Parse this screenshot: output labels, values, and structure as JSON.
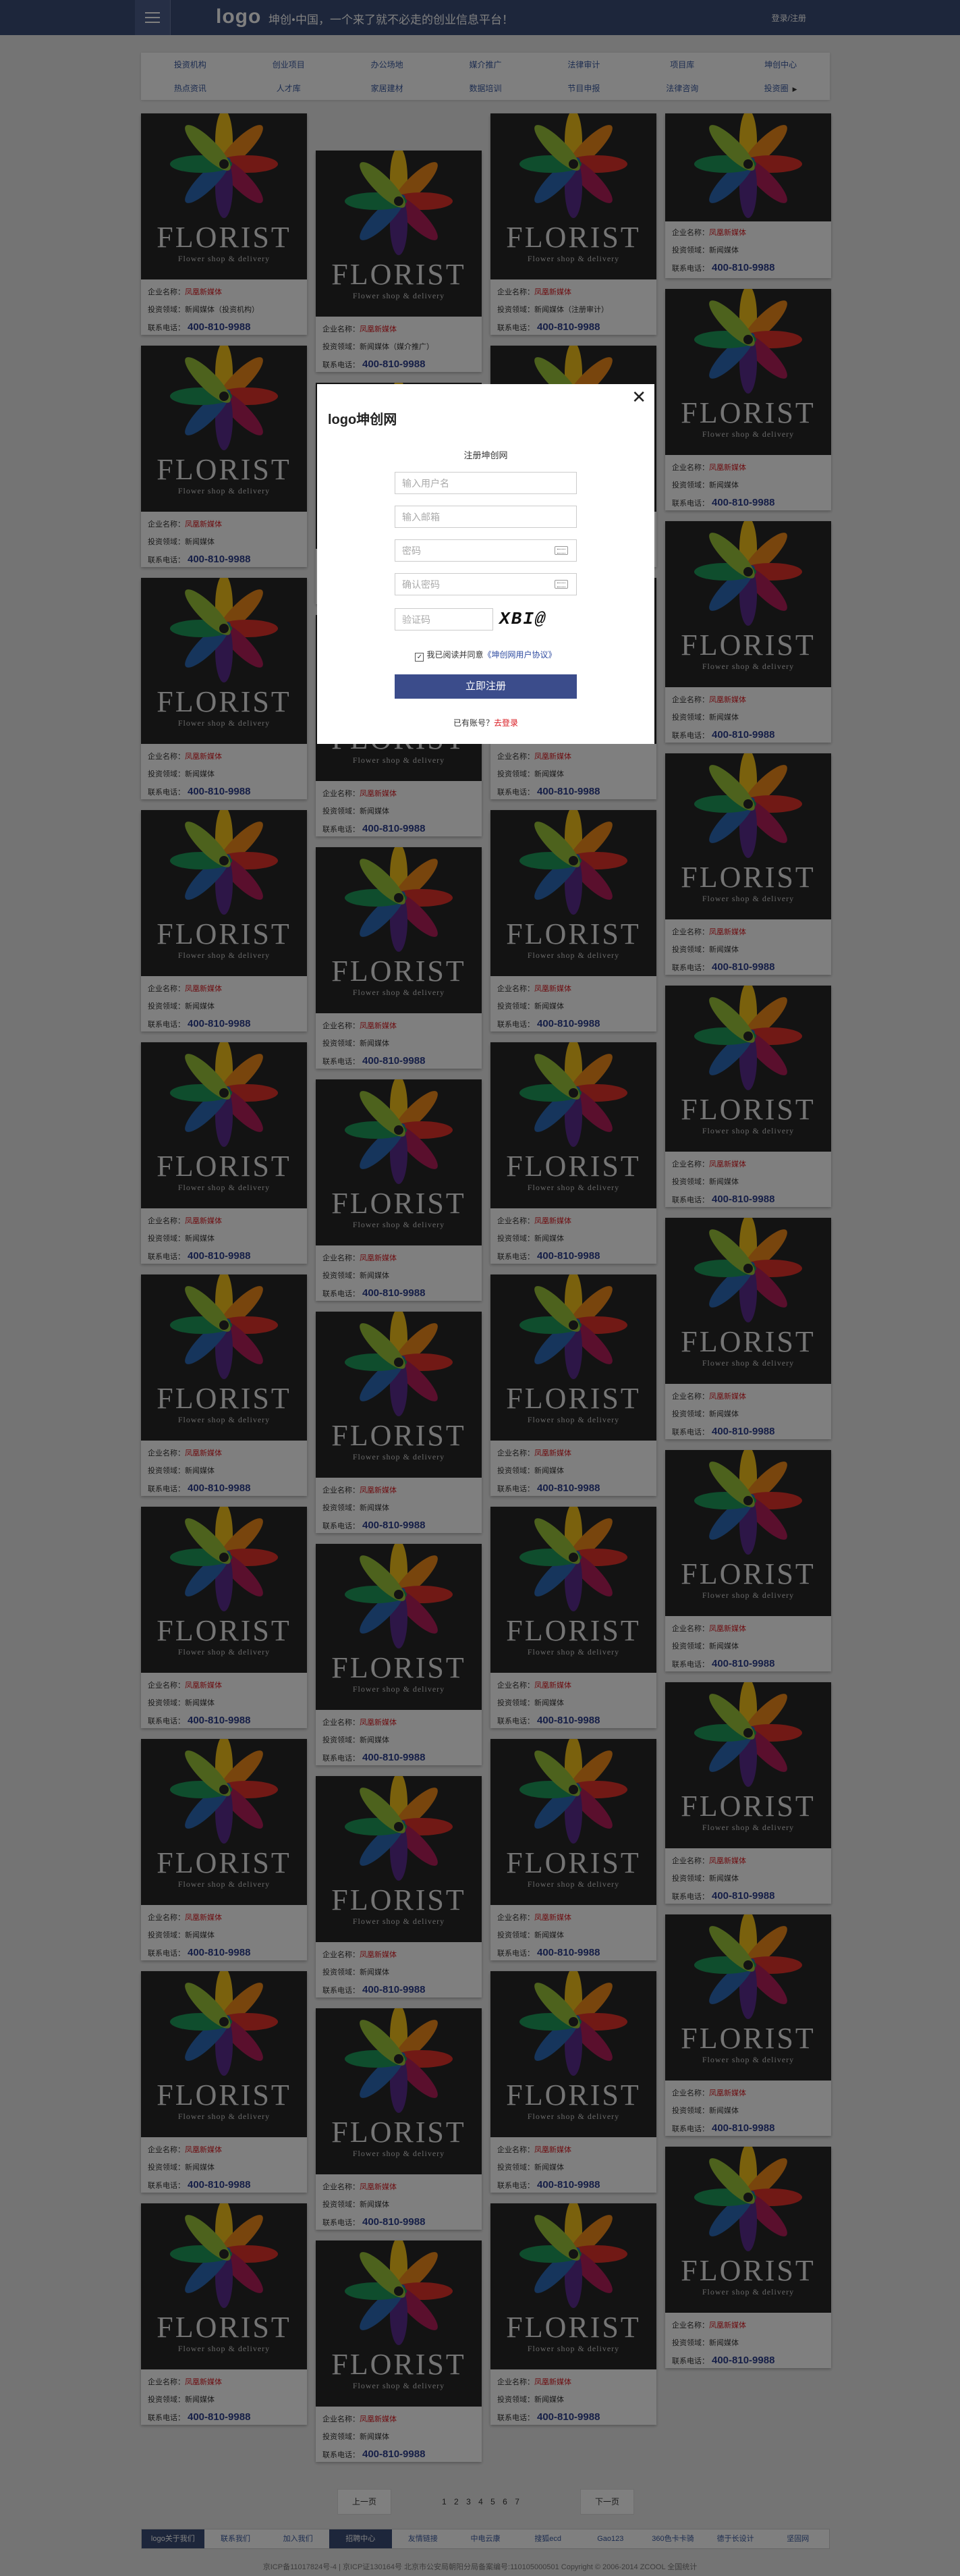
{
  "header": {
    "logo": "logo",
    "slogan": "坤创•中国，一个来了就不必走的创业信息平台！",
    "login": "登录",
    "separator": "/",
    "register": "注册"
  },
  "nav": {
    "row1": [
      "投资机构",
      "创业项目",
      "办公场地",
      "媒介推广",
      "法律审计",
      "项目库",
      "坤创中心"
    ],
    "row2": [
      "热点资讯",
      "人才库",
      "家居建材",
      "数据培训",
      "节目申报",
      "法律咨询",
      "投资圈"
    ]
  },
  "card": {
    "brand": "FLORIST",
    "brand_sub": "Flower shop & delivery",
    "company_label": "企业名称：",
    "company_value": "凤凰新媒体",
    "field_label": "投资领域：",
    "field_value": "新闻媒体",
    "phone_label": "联系电话：",
    "phone_value": "400-810-9988",
    "field_alt_1": "新闻媒体（投资机构）",
    "field_alt_2": "新闻媒体（注册审计）",
    "field_alt_3": "新闻媒体（媒介推广）"
  },
  "modal": {
    "logo": "logo坤创网",
    "title": "注册坤创网",
    "username_ph": "输入用户名",
    "email_ph": "输入邮箱",
    "password_ph": "密码",
    "confirm_ph": "确认密码",
    "captcha_ph": "验证码",
    "captcha_text": "XBI@",
    "agree_text": "我已阅读并同意",
    "agree_link": "《坤创网用户协议》",
    "submit": "立即注册",
    "has_account": "已有账号？",
    "login_link": "去登录"
  },
  "pager": {
    "prev": "上一页",
    "next": "下一页",
    "pages": [
      "1",
      "2",
      "3",
      "4",
      "5",
      "6",
      "7"
    ]
  },
  "footer": {
    "links": [
      "logo关于我们",
      "联系我们",
      "加入我们",
      "招聘中心",
      "友情链接",
      "中电云康",
      "搜狐ecd",
      "Gao123",
      "360色卡卡骑",
      "德于长设计",
      "坚固网"
    ],
    "copyright": "京ICP备11017824号-4 | 京ICP证130164号 北京市公安局朝阳分局备案编号:110105000501 Copyright © 2006-2014 ZCOOL 全国统计"
  },
  "colors": {
    "header": "#3b4c77",
    "accent_red": "#d9181f",
    "phone_blue": "#2d3f8f",
    "submit": "#3b4c8b"
  }
}
